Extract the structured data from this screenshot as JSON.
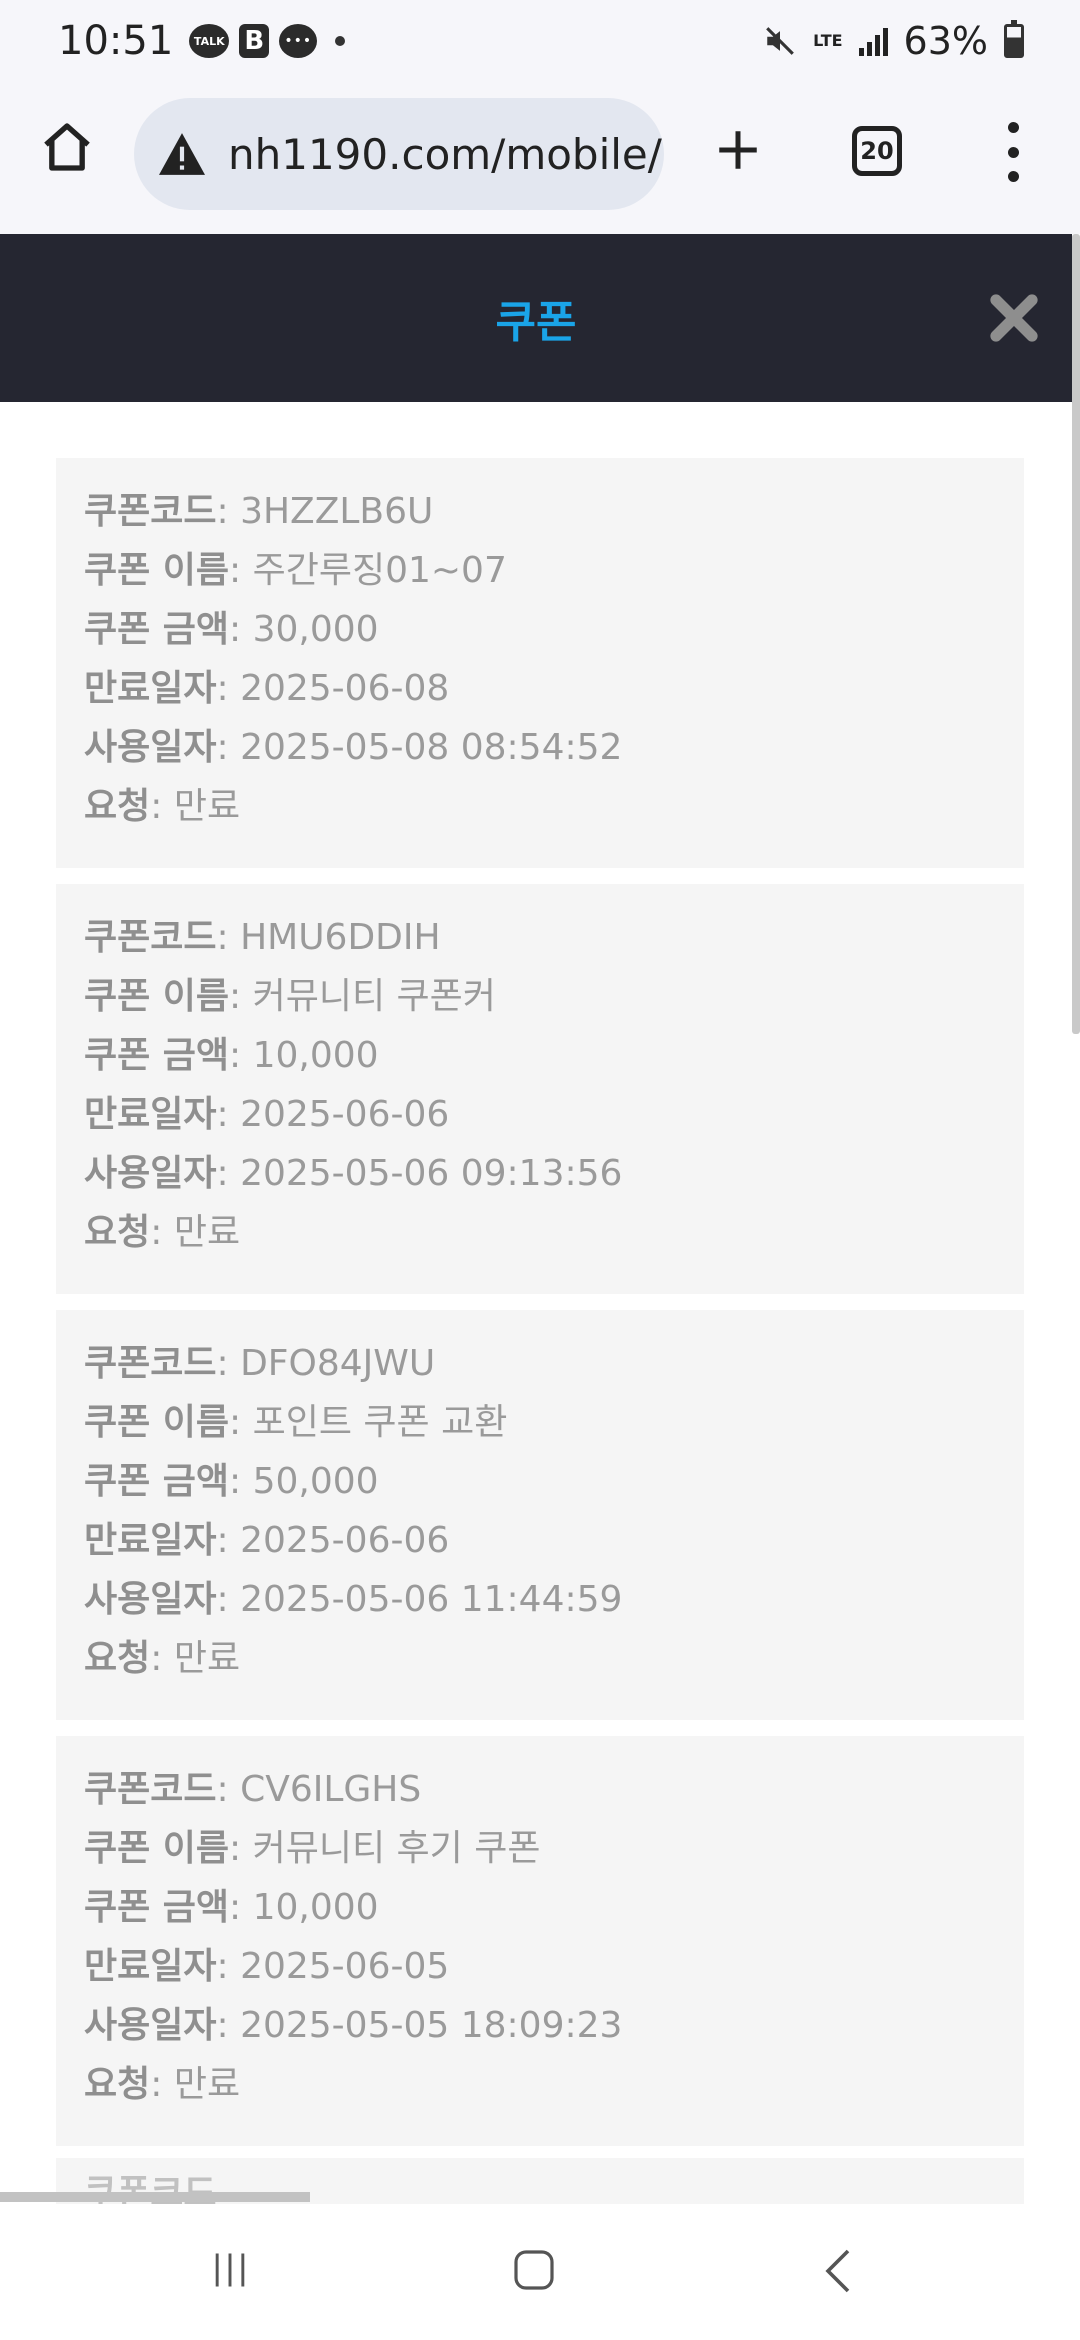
{
  "status": {
    "time": "10:51",
    "talk_icon_text": "TALK",
    "b_icon_text": "B",
    "battery": "63%",
    "network": "LTE"
  },
  "browser": {
    "url": "nh1190.com/mobile/",
    "tab_count": "20"
  },
  "page": {
    "title": "쿠폰"
  },
  "labels": {
    "code": "쿠폰코드",
    "name": "쿠폰 이름",
    "amount": "쿠폰 금액",
    "expiry": "만료일자",
    "used": "사용일자",
    "request": "요청"
  },
  "coupons": [
    {
      "code": "3HZZLB6U",
      "name": "주간루징01~07",
      "amount": "30,000",
      "expiry": "2025-06-08",
      "used": "2025-05-08 08:54:52",
      "request": "만료"
    },
    {
      "code": "HMU6DDIH",
      "name": "커뮤니티 쿠폰커",
      "amount": "10,000",
      "expiry": "2025-06-06",
      "used": "2025-05-06 09:13:56",
      "request": "만료"
    },
    {
      "code": "DFO84JWU",
      "name": "포인트 쿠폰 교환",
      "amount": "50,000",
      "expiry": "2025-06-06",
      "used": "2025-05-06 11:44:59",
      "request": "만료"
    },
    {
      "code": "CV6ILGHS",
      "name": "커뮤니티 후기 쿠폰",
      "amount": "10,000",
      "expiry": "2025-06-05",
      "used": "2025-05-05 18:09:23",
      "request": "만료"
    }
  ]
}
